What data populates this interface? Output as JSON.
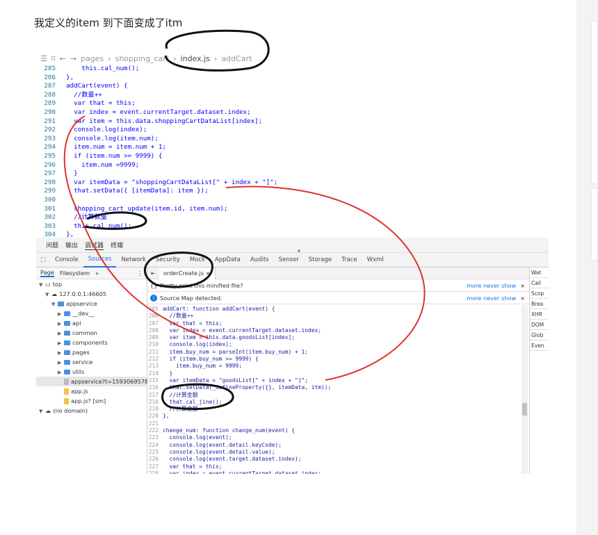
{
  "question": {
    "text": "我定义的item 到下面变成了itm"
  },
  "editor": {
    "breadcrumb": [
      "pages",
      "shopping_cart",
      "index.js",
      "addCart"
    ],
    "lines": [
      {
        "n": "285",
        "t": "      this.cal_num();"
      },
      {
        "n": "286",
        "t": "  },"
      },
      {
        "n": "287",
        "t": "  addCart(event) {"
      },
      {
        "n": "288",
        "t": "    //数量++"
      },
      {
        "n": "289",
        "t": "    var that = this;"
      },
      {
        "n": "290",
        "t": "    var index = event.currentTarget.dataset.index;"
      },
      {
        "n": "291",
        "t": "    var item = this.data.shoppingCartDataList[index];"
      },
      {
        "n": "292",
        "t": "    console.log(index);"
      },
      {
        "n": "293",
        "t": "    console.log(item.num);"
      },
      {
        "n": "294",
        "t": "    item.num = item.num + 1;"
      },
      {
        "n": "295",
        "t": "    if (item.num >= 9999) {"
      },
      {
        "n": "296",
        "t": "      item.num =9999;"
      },
      {
        "n": "297",
        "t": "    }"
      },
      {
        "n": "298",
        "t": "    var itemData = \"shoppingCartDataList[\" + index + \"]\";"
      },
      {
        "n": "299",
        "t": "    that.setData({ [itemData]: item });"
      },
      {
        "n": "300",
        "t": ""
      },
      {
        "n": "301",
        "t": "    shopping_cart_update(item.id, item.num);"
      },
      {
        "n": "302",
        "t": "    //计算数量"
      },
      {
        "n": "303",
        "t": "    this.cal_num();"
      },
      {
        "n": "304",
        "t": "  },"
      }
    ]
  },
  "devtools": {
    "top_tabs": [
      "问题",
      "输出",
      "调试器",
      "终端"
    ],
    "tabs": [
      "Console",
      "Sources",
      "Network",
      "Security",
      "Mock",
      "AppData",
      "Audits",
      "Sensor",
      "Storage",
      "Trace",
      "Wxml"
    ],
    "left_tabs": [
      "Page",
      "Filesystem"
    ],
    "tree": [
      {
        "label": "top",
        "depth": 0,
        "kind": "frame"
      },
      {
        "label": "127.0.0.1:46605",
        "depth": 1,
        "kind": "cloud"
      },
      {
        "label": "appservice",
        "depth": 2,
        "kind": "folder"
      },
      {
        "label": "__dev__",
        "depth": 3,
        "kind": "folder"
      },
      {
        "label": "api",
        "depth": 3,
        "kind": "folder"
      },
      {
        "label": "common",
        "depth": 3,
        "kind": "folder"
      },
      {
        "label": "components",
        "depth": 3,
        "kind": "folder"
      },
      {
        "label": "pages",
        "depth": 3,
        "kind": "folder"
      },
      {
        "label": "service",
        "depth": 3,
        "kind": "folder"
      },
      {
        "label": "utils",
        "depth": 3,
        "kind": "folder"
      },
      {
        "label": "appservice?t=15930695782",
        "depth": 3,
        "kind": "grey"
      },
      {
        "label": "app.js",
        "depth": 3,
        "kind": "file"
      },
      {
        "label": "app.js? [sm]",
        "depth": 3,
        "kind": "file"
      },
      {
        "label": "(no domain)",
        "depth": 0,
        "kind": "cloud"
      }
    ],
    "file_tab": "orderCreate.js",
    "pretty_print": "Pretty-print this minified file?",
    "source_map": "Source Map detected.",
    "links": "more  never show",
    "right_items": [
      "Wat",
      "Call",
      "Scop",
      "Brea",
      "XHR",
      "DOM",
      "Glob",
      "Even"
    ],
    "src_lines": [
      {
        "n": "205",
        "t": "addCart: function addCart(event) {"
      },
      {
        "n": "206",
        "t": "  //数量++"
      },
      {
        "n": "207",
        "t": "  var that = this;"
      },
      {
        "n": "208",
        "t": "  var index = event.currentTarget.dataset.index;"
      },
      {
        "n": "209",
        "t": "  var item = this.data.goodsList[index];"
      },
      {
        "n": "210",
        "t": "  console.log(index);"
      },
      {
        "n": "211",
        "t": "  item.buy_num = parseInt(item.buy_num) + 1;"
      },
      {
        "n": "212",
        "t": "  if (item.buy_num >= 9999) {"
      },
      {
        "n": "213",
        "t": "    item.buy_num = 9999;"
      },
      {
        "n": "214",
        "t": "  }"
      },
      {
        "n": "215",
        "t": "  var itemData = \"goodsList[\" + index + \"]\";"
      },
      {
        "n": "216",
        "t": "  that.setData(_defineProperty({}, itemData, itm));"
      },
      {
        "n": "217",
        "t": "  //计算金额"
      },
      {
        "n": "218",
        "t": "  that.cal_jine();"
      },
      {
        "n": "219",
        "t": "  //计算金额"
      },
      {
        "n": "220",
        "t": "},"
      },
      {
        "n": "221",
        "t": ""
      },
      {
        "n": "222",
        "t": "change_num: function change_num(event) {"
      },
      {
        "n": "223",
        "t": "  console.log(event);"
      },
      {
        "n": "224",
        "t": "  console.log(event.detail.keyCode);"
      },
      {
        "n": "225",
        "t": "  console.log(event.detail.value);"
      },
      {
        "n": "226",
        "t": "  console.log(event.target.dataset.index);"
      },
      {
        "n": "227",
        "t": "  var that = this;"
      },
      {
        "n": "228",
        "t": "  var index = event.currentTarget.dataset.index;"
      },
      {
        "n": "229",
        "t": "  ..."
      }
    ]
  },
  "colors": {
    "annotation_black": "#111111",
    "annotation_red": "#e0302a",
    "accent": "#1a73e8"
  }
}
